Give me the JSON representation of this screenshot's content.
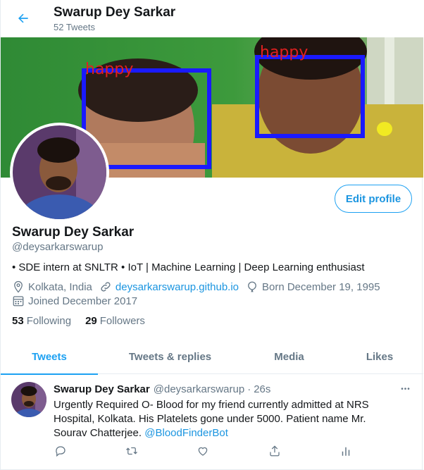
{
  "header": {
    "name": "Swarup Dey Sarkar",
    "tweet_count": "52 Tweets"
  },
  "banner": {
    "labels": [
      "happy",
      "happy"
    ]
  },
  "profile": {
    "name": "Swarup Dey Sarkar",
    "handle": "@deysarkarswarup",
    "edit_label": "Edit profile",
    "bio": "• SDE intern at SNLTR • IoT | Machine Learning | Deep Learning enthusiast",
    "location": "Kolkata, India",
    "website": "deysarkarswarup.github.io",
    "birthday": "Born December 19, 1995",
    "joined": "Joined December 2017",
    "following_count": "53",
    "following_label": "Following",
    "followers_count": "29",
    "followers_label": "Followers"
  },
  "tabs": [
    {
      "label": "Tweets",
      "active": true
    },
    {
      "label": "Tweets & replies",
      "active": false
    },
    {
      "label": "Media",
      "active": false
    },
    {
      "label": "Likes",
      "active": false
    }
  ],
  "tweet": {
    "author": "Swarup Dey Sarkar",
    "handle": "@deysarkarswarup",
    "separator": "·",
    "time": "26s",
    "more": "•••",
    "text": "Urgently Required O- Blood for my friend currently admitted at NRS Hospital, Kolkata. His Platelets gone under 5000. Patient name Mr. Sourav Chatterjee.",
    "mention": "@BloodFinderBot"
  },
  "icons": {
    "back": "arrow-left-icon",
    "location": "location-pin-icon",
    "link": "link-icon",
    "birthday": "balloon-icon",
    "calendar": "calendar-icon",
    "reply": "reply-icon",
    "retweet": "retweet-icon",
    "like": "heart-icon",
    "share": "share-icon",
    "analytics": "analytics-icon"
  },
  "colors": {
    "accent": "#1da1f2",
    "link": "#1b95e0",
    "secondary_text": "#657786",
    "border": "#e6ecf0"
  }
}
